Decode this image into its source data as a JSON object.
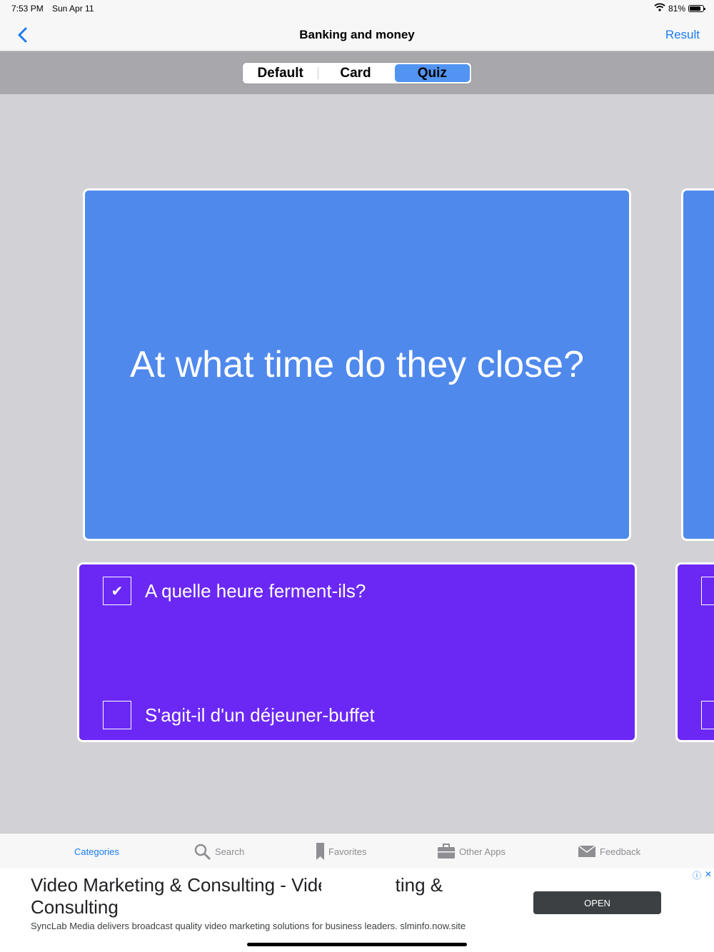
{
  "status_bar": {
    "time": "7:53 PM",
    "date": "Sun Apr 11",
    "battery": "81%",
    "battery_level": 0.81
  },
  "nav": {
    "title": "Banking and money",
    "right_button": "Result"
  },
  "segments": [
    {
      "label": "Default",
      "active": false
    },
    {
      "label": "Card",
      "active": false
    },
    {
      "label": "Quiz",
      "active": true
    }
  ],
  "quiz": {
    "question": "At what time do they close?",
    "options": [
      {
        "label": "A quelle heure ferment-ils?",
        "checked": true,
        "mark": "✔"
      },
      {
        "label": "S'agit-il d'un déjeuner-buffet",
        "checked": false,
        "mark": ""
      }
    ]
  },
  "tabs": [
    {
      "label": "Categories",
      "icon": "categories-icon",
      "active": true
    },
    {
      "label": "Search",
      "icon": "search-icon",
      "active": false
    },
    {
      "label": "Favorites",
      "icon": "bookmark-icon",
      "active": false
    },
    {
      "label": "Other Apps",
      "icon": "briefcase-icon",
      "active": false
    },
    {
      "label": "Feedback",
      "icon": "envelope-icon",
      "active": false
    }
  ],
  "ad": {
    "title": "Video Marketing & Consulting - Video Marketing & Consulting",
    "description": "SyncLab Media delivers broadcast quality video marketing solutions for business leaders. slminfo.now.site",
    "cta": "OPEN"
  },
  "colors": {
    "accent": "#1a7bf2",
    "question_card": "#4f89ec",
    "answer_card": "#6b28f5",
    "active_segment": "#5294f2",
    "background": "#d1d1d6"
  }
}
